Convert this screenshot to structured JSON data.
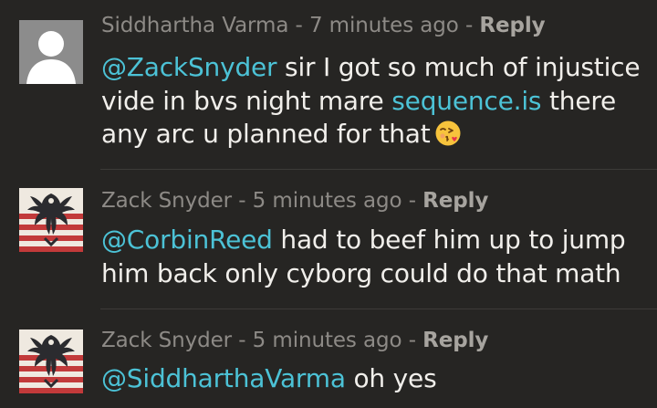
{
  "comments": [
    {
      "author": "Siddhartha Varma",
      "time": "7 minutes ago",
      "sep1": " - ",
      "sep2": " - ",
      "reply_label": "Reply",
      "mention": "@ZackSnyder",
      "text_before_link": " sir I got so much of injustice vide in bvs night mare ",
      "link_text": "sequence.is",
      "text_after_link": " there any arc u planned for that",
      "avatar_icon": "default-user-silhouette-icon",
      "emoji_icon": "face-blowing-kiss-emoji-icon"
    },
    {
      "author": "Zack Snyder",
      "time": "5 minutes ago",
      "sep1": " - ",
      "sep2": " - ",
      "reply_label": "Reply",
      "mention": "@CorbinReed",
      "text": " had to beef him up to jump him back only cyborg could do that math",
      "avatar_icon": "striped-flag-bird-avatar-icon"
    },
    {
      "author": "Zack Snyder",
      "time": "5 minutes ago",
      "sep1": " - ",
      "sep2": " - ",
      "reply_label": "Reply",
      "mention": "@SiddharthaVarma",
      "text": " oh yes",
      "avatar_icon": "striped-flag-bird-avatar-icon"
    }
  ],
  "colors": {
    "background": "#262523",
    "meta_text": "#8d8a86",
    "body_text": "#f1efeb",
    "mention_link": "#4cc2d6"
  }
}
